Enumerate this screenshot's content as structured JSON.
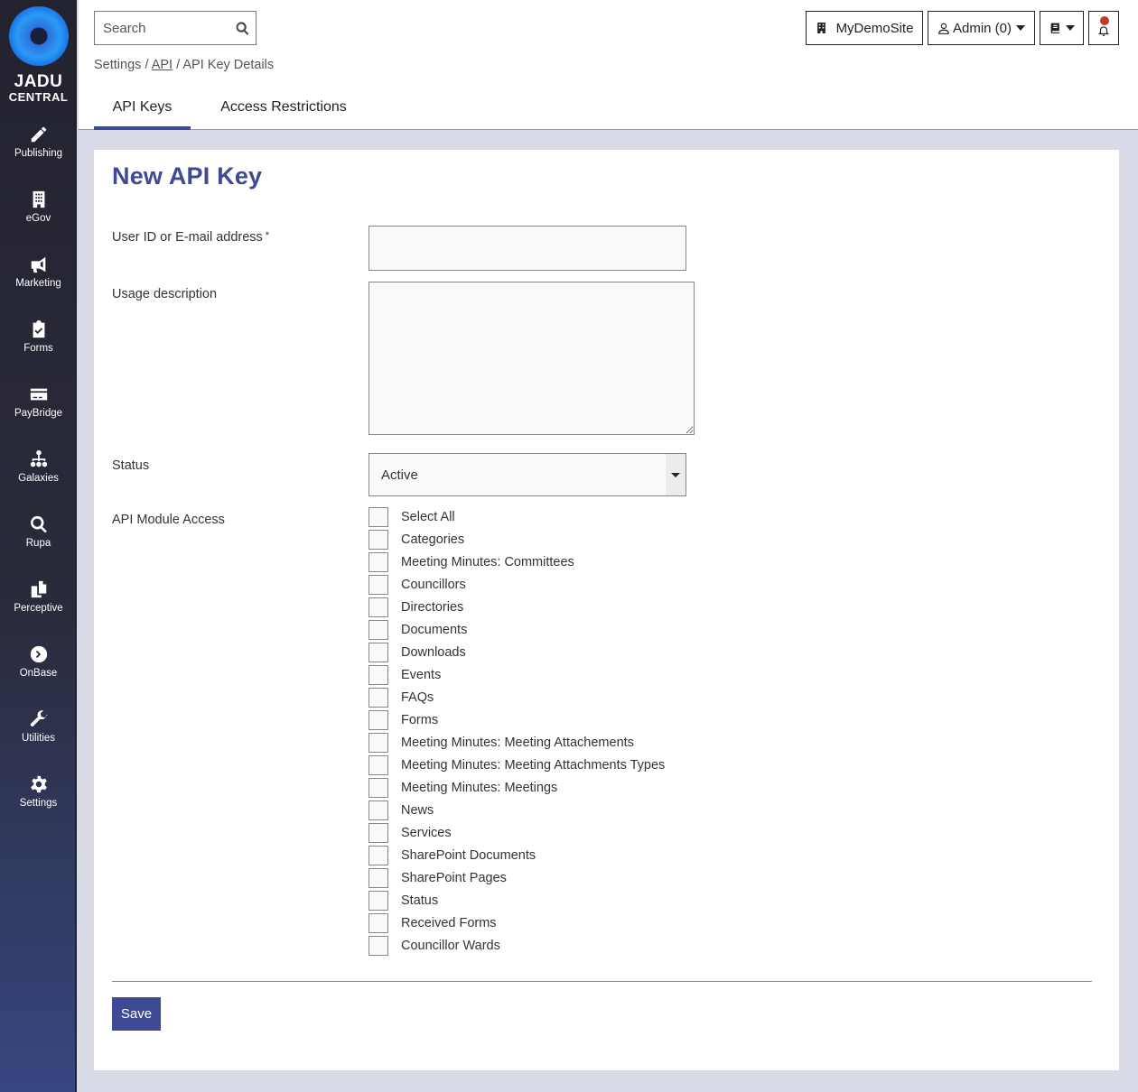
{
  "brand": {
    "line1": "JADU",
    "line2": "CENTRAL"
  },
  "sidebar": {
    "items": [
      {
        "label": "Publishing",
        "icon": "pencil-icon"
      },
      {
        "label": "eGov",
        "icon": "building-icon"
      },
      {
        "label": "Marketing",
        "icon": "megaphone-icon"
      },
      {
        "label": "Forms",
        "icon": "clipboard-check-icon"
      },
      {
        "label": "PayBridge",
        "icon": "credit-card-icon"
      },
      {
        "label": "Galaxies",
        "icon": "sitemap-icon"
      },
      {
        "label": "Rupa",
        "icon": "search-icon"
      },
      {
        "label": "Perceptive",
        "icon": "copy-icon"
      },
      {
        "label": "OnBase",
        "icon": "chevron-circle-right-icon"
      },
      {
        "label": "Utilities",
        "icon": "wrench-icon"
      },
      {
        "label": "Settings",
        "icon": "gear-icon"
      }
    ]
  },
  "header": {
    "search_placeholder": "Search",
    "breadcrumb": {
      "root": "Settings",
      "sep": "/",
      "link": "API",
      "current": "API Key Details"
    },
    "site_button": "MyDemoSite",
    "admin_button": "Admin (0)",
    "tabs": [
      {
        "label": "API Keys",
        "active": true
      },
      {
        "label": "Access Restrictions",
        "active": false
      }
    ]
  },
  "form": {
    "title": "New API Key",
    "user_label": "User ID or E-mail address",
    "required_mark": "*",
    "user_value": "",
    "description_label": "Usage description",
    "description_value": "",
    "status_label": "Status",
    "status_value": "Active",
    "module_label": "API Module Access",
    "modules": [
      {
        "label": "Select All",
        "checked": false
      },
      {
        "label": "Categories",
        "checked": false
      },
      {
        "label": "Meeting Minutes: Committees",
        "checked": false
      },
      {
        "label": "Councillors",
        "checked": false
      },
      {
        "label": "Directories",
        "checked": false
      },
      {
        "label": "Documents",
        "checked": false
      },
      {
        "label": "Downloads",
        "checked": false
      },
      {
        "label": "Events",
        "checked": false
      },
      {
        "label": "FAQs",
        "checked": false
      },
      {
        "label": "Forms",
        "checked": false
      },
      {
        "label": "Meeting Minutes: Meeting Attachements",
        "checked": false
      },
      {
        "label": "Meeting Minutes: Meeting Attachments Types",
        "checked": false
      },
      {
        "label": "Meeting Minutes: Meetings",
        "checked": false
      },
      {
        "label": "News",
        "checked": false
      },
      {
        "label": "Services",
        "checked": false
      },
      {
        "label": "SharePoint Documents",
        "checked": false
      },
      {
        "label": "SharePoint Pages",
        "checked": false
      },
      {
        "label": "Status",
        "checked": false
      },
      {
        "label": "Received Forms",
        "checked": false
      },
      {
        "label": "Councillor Wards",
        "checked": false
      }
    ],
    "save_label": "Save"
  },
  "colors": {
    "accent": "#3f4a94",
    "sidebar_top": "#23232f",
    "sidebar_bottom": "#36467f",
    "page_bg": "#d8dae6",
    "notification": "#c0392b"
  }
}
